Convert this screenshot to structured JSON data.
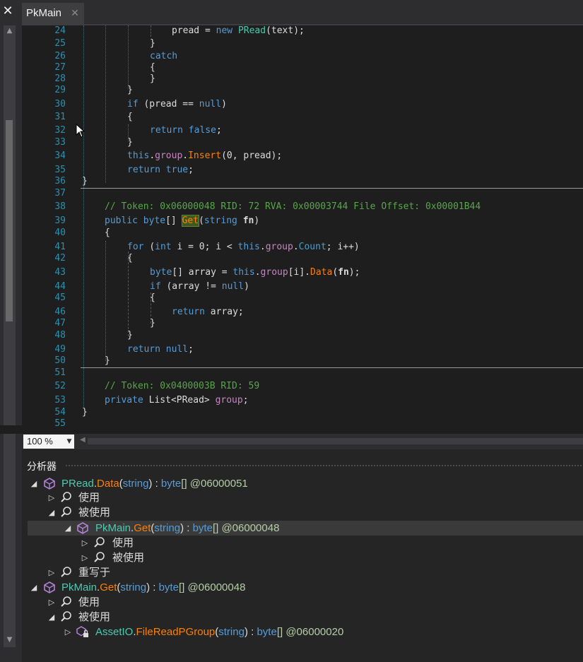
{
  "tab": {
    "title": "PkMain",
    "close": "✕"
  },
  "left": {
    "close": "✕"
  },
  "editor": {
    "line_numbers": [
      "24",
      "25",
      "26",
      "27",
      "28",
      "29",
      "30",
      "31",
      "32",
      "33",
      "34",
      "35",
      "36",
      "37",
      "38",
      "39",
      "40",
      "41",
      "42",
      "43",
      "44",
      "45",
      "46",
      "47",
      "48",
      "49",
      "50",
      "51",
      "52",
      "53",
      "54",
      "55"
    ],
    "l24": {
      "a": "pread = ",
      "b": "new ",
      "c": "PRead",
      "d": "(text);"
    },
    "l25": "}",
    "l26": "catch",
    "l27": "{",
    "l28": "}",
    "l29": "}",
    "l30": {
      "a": "if ",
      "b": "(pread == ",
      "c": "null",
      "d": ")"
    },
    "l31": "{",
    "l32": {
      "a": "return ",
      "b": "false",
      "c": ";"
    },
    "l33": "}",
    "l34": {
      "a": "this",
      "b": ".",
      "c": "group",
      "d": ".",
      "e": "Insert",
      "f": "(0, pread);"
    },
    "l35": {
      "a": "return ",
      "b": "true",
      "c": ";"
    },
    "l36": "}",
    "l38": "// Token: 0x06000048 RID: 72 RVA: 0x00003744 File Offset: 0x00001B44",
    "l39": {
      "a": "public ",
      "b": "byte",
      "c": "[] ",
      "d": "Get",
      "e": "(",
      "f": "string ",
      "g": "fn",
      "h": ")"
    },
    "l40": "{",
    "l41": {
      "a": "for ",
      "b": "(",
      "c": "int ",
      "d": "i = 0; i < ",
      "e": "this",
      "f": ".",
      "g": "group",
      "h": ".",
      "i": "Count",
      "j": "; i++)"
    },
    "l42": "{",
    "l43": {
      "a": "byte",
      "b": "[] array = ",
      "c": "this",
      "d": ".",
      "e": "group",
      "f": "[i].",
      "g": "Data",
      "h": "(",
      "i": "fn",
      "j": ");"
    },
    "l44": {
      "a": "if ",
      "b": "(array != ",
      "c": "null",
      "d": ")"
    },
    "l45": "{",
    "l46": {
      "a": "return ",
      "b": "array;"
    },
    "l47": "}",
    "l48": "}",
    "l49": {
      "a": "return ",
      "b": "null",
      "c": ";"
    },
    "l50": "}",
    "l52": "// Token: 0x0400003B RID: 59",
    "l53": {
      "a": "private ",
      "b": "List",
      "c": "<",
      "d": "PRead",
      "e": "> ",
      "f": "group",
      "g": ";"
    },
    "l54": "}"
  },
  "zoom": {
    "value": "100 %"
  },
  "analyzer": {
    "title": "分析器",
    "r1": {
      "cls": "PRead",
      "dot": ".",
      "mth": "Data",
      "p1": "(",
      "kw": "string",
      "p2": ") : ",
      "ret": "byte",
      "rest": "[] @06000051"
    },
    "r2": "使用",
    "r3": "被使用",
    "r4": {
      "cls": "PkMain",
      "dot": ".",
      "mth": "Get",
      "p1": "(",
      "kw": "string",
      "p2": ") : ",
      "ret": "byte",
      "rest": "[] @06000048"
    },
    "r5": "使用",
    "r6": "被使用",
    "r7": "重写于",
    "r8": {
      "cls": "PkMain",
      "dot": ".",
      "mth": "Get",
      "p1": "(",
      "kw": "string",
      "p2": ") : ",
      "ret": "byte",
      "rest": "[] @06000048"
    },
    "r9": "使用",
    "r10": "被使用",
    "r11": {
      "cls": "AssetIO",
      "dot": ".",
      "mth": "FileReadPGroup",
      "p1": "(",
      "kw": "string",
      "p2": ") : ",
      "ret": "byte",
      "rest": "[] @06000020"
    }
  }
}
